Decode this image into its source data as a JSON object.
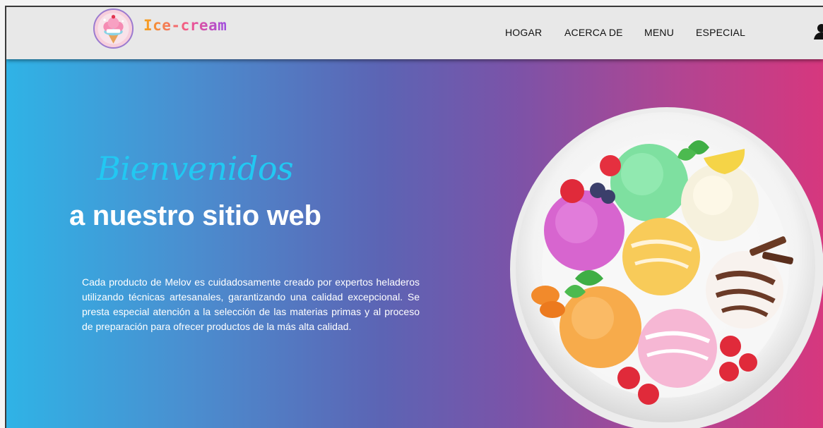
{
  "brand": {
    "name": "Ice-cream",
    "logo_icon": "ice-cream-logo-icon"
  },
  "nav": {
    "items": [
      {
        "label": "HOGAR"
      },
      {
        "label": "ACERCA DE"
      },
      {
        "label": "MENU"
      },
      {
        "label": "ESPECIAL"
      }
    ],
    "user_icon": "user-icon"
  },
  "hero": {
    "title": "Bienvenidos",
    "subtitle": "a nuestro sitio web",
    "description": "Cada producto de Melov es cuidadosamente creado por expertos heladeros utilizando técnicas artesanales, garantizando una calidad excepcional. Se presta especial atención a la selección de las materias primas y al proceso de preparación para ofrecer productos de la más alta calidad.",
    "image_icon": "ice-cream-plate-image"
  },
  "colors": {
    "gradient_start": "#2fb3e6",
    "gradient_end": "#d6377e",
    "title_color": "#22c8f2",
    "navbar_bg": "#e8e8e8"
  }
}
